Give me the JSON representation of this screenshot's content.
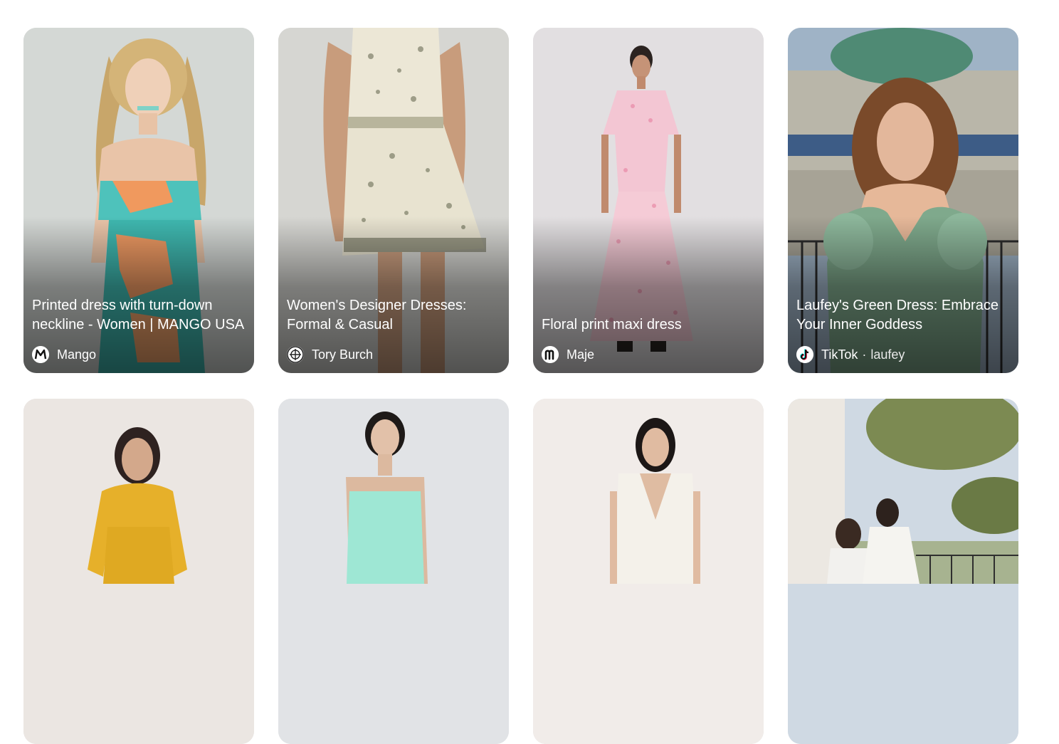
{
  "results": [
    {
      "title": "Printed dress with turn-down neckline - Women | MANGO USA",
      "source": "Mango",
      "author": "",
      "favicon": "mango-logo-icon",
      "image": "woman-in-teal-orange-printed-strapless-dress"
    },
    {
      "title": "Women's Designer Dresses: Formal & Casual",
      "source": "Tory Burch",
      "author": "",
      "favicon": "tory-burch-logo-icon",
      "image": "floral-embroidered-mini-dress-back-view"
    },
    {
      "title": "Floral print maxi dress",
      "source": "Maje",
      "author": "",
      "favicon": "maje-logo-icon",
      "image": "woman-in-pink-floral-cutout-maxi-dress"
    },
    {
      "title": "Laufey's Green Dress: Embrace Your Inner Goddess",
      "source": "TikTok",
      "author": "laufey",
      "favicon": "tiktok-logo-icon",
      "image": "woman-in-sage-green-puff-sleeve-dress-on-balcony"
    },
    {
      "title": "",
      "source": "",
      "author": "",
      "favicon": "",
      "image": "woman-in-mustard-yellow-dress"
    },
    {
      "title": "",
      "source": "",
      "author": "",
      "favicon": "",
      "image": "woman-in-mint-sequin-strapless-dress"
    },
    {
      "title": "",
      "source": "",
      "author": "",
      "favicon": "",
      "image": "woman-in-white-v-neck-dress"
    },
    {
      "title": "",
      "source": "",
      "author": "",
      "favicon": "",
      "image": "two-women-in-white-dresses-outdoors"
    }
  ]
}
